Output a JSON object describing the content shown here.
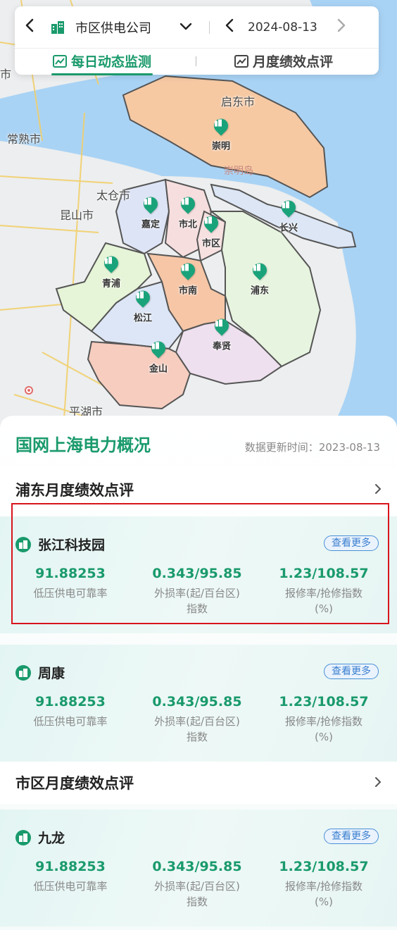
{
  "header": {
    "company": "市区供电公司",
    "date": "2024-08-13",
    "tabs": [
      {
        "label": "每日动态监测",
        "active": true
      },
      {
        "label": "月度绩效点评",
        "active": false
      }
    ]
  },
  "map": {
    "place_labels": {
      "qidong": "启东市",
      "changshu": "常熟市",
      "taicang": "太仓市",
      "kunshan": "昆山市",
      "pinghu": "平湖市",
      "chongming_island": "崇明岛",
      "shi": "市"
    },
    "districts": {
      "chongming": "崇明",
      "changxing": "长兴",
      "jiading": "嘉定",
      "shibei": "市北",
      "shiqu": "市区",
      "qingpu": "青浦",
      "shinan": "市南",
      "pudong": "浦东",
      "songjiang": "松江",
      "fengxian": "奉贤",
      "jinshan": "金山"
    }
  },
  "overview": {
    "title": "国网上海电力概况",
    "update_label": "数据更新时间：",
    "update_date": "2023-08-13"
  },
  "sections": [
    {
      "title": "浦东月度绩效点评",
      "cards": [
        {
          "name": "张江科技园",
          "more": "查看更多",
          "metrics": [
            {
              "value": "91.88253",
              "label_line1": "低压供电可靠率",
              "label_line2": ""
            },
            {
              "value": "0.343/95.85",
              "label_line1": "外损率(起/百台区)",
              "label_line2": "指数"
            },
            {
              "value": "1.23/108.57",
              "label_line1": "报修率/抢修指数",
              "label_line2": "(%)"
            }
          ]
        },
        {
          "name": "周康",
          "more": "查看更多",
          "metrics": [
            {
              "value": "91.88253",
              "label_line1": "低压供电可靠率",
              "label_line2": ""
            },
            {
              "value": "0.343/95.85",
              "label_line1": "外损率(起/百台区)",
              "label_line2": "指数"
            },
            {
              "value": "1.23/108.57",
              "label_line1": "报修率/抢修指数",
              "label_line2": "(%)"
            }
          ]
        }
      ]
    },
    {
      "title": "市区月度绩效点评",
      "cards": [
        {
          "name": "九龙",
          "more": "查看更多",
          "metrics": [
            {
              "value": "91.88253",
              "label_line1": "低压供电可靠率",
              "label_line2": ""
            },
            {
              "value": "0.343/95.85",
              "label_line1": "外损率(起/百台区)",
              "label_line2": "指数"
            },
            {
              "value": "1.23/108.57",
              "label_line1": "报修率/抢修指数",
              "label_line2": "(%)"
            }
          ]
        }
      ]
    }
  ],
  "colors": {
    "accent": "#1a9a6c",
    "link": "#3a7fcf",
    "highlight": "#d9141c",
    "water": "#a9d3f5"
  }
}
